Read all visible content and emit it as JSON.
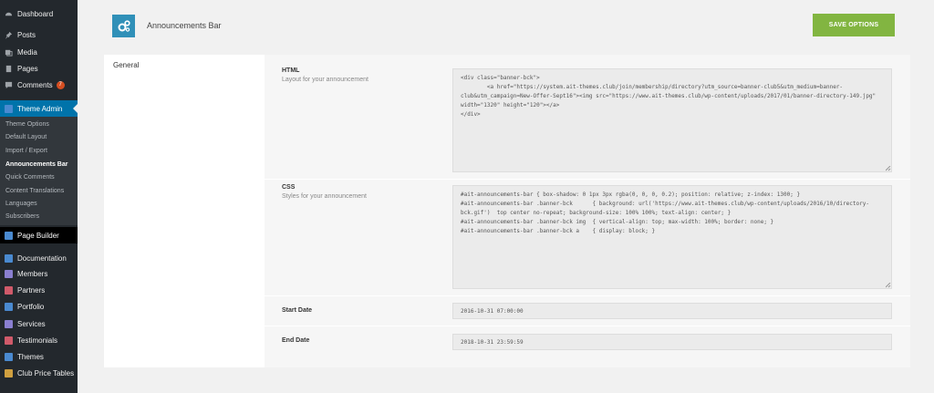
{
  "sidebar": {
    "top_items": [
      {
        "label": "Dashboard",
        "icon": "dashboard-icon"
      },
      {
        "label": "Posts",
        "icon": "pin-icon"
      },
      {
        "label": "Media",
        "icon": "media-icon"
      },
      {
        "label": "Pages",
        "icon": "pages-icon"
      },
      {
        "label": "Comments",
        "icon": "comments-icon",
        "badge": "7"
      }
    ],
    "theme_admin": {
      "label": "Theme Admin",
      "icon": "ait-icon"
    },
    "submenu": [
      {
        "label": "Theme Options"
      },
      {
        "label": "Default Layout"
      },
      {
        "label": "Import / Export"
      },
      {
        "label": "Announcements Bar"
      },
      {
        "label": "Quick Comments"
      },
      {
        "label": "Content Translations"
      },
      {
        "label": "Languages"
      },
      {
        "label": "Subscribers"
      }
    ],
    "page_builder": {
      "label": "Page Builder",
      "icon": "ait-icon"
    },
    "bottom_items": [
      {
        "label": "Documentation",
        "icon": "documentation-icon"
      },
      {
        "label": "Members",
        "icon": "members-icon"
      },
      {
        "label": "Partners",
        "icon": "partners-icon"
      },
      {
        "label": "Portfolio",
        "icon": "portfolio-icon"
      },
      {
        "label": "Services",
        "icon": "services-icon"
      },
      {
        "label": "Testimonials",
        "icon": "testimonials-icon"
      },
      {
        "label": "Themes",
        "icon": "themes-icon"
      },
      {
        "label": "Club Price Tables",
        "icon": "price-tables-icon"
      }
    ]
  },
  "header": {
    "title": "Announcements Bar",
    "icon": "gears-icon",
    "save_label": "SAVE OPTIONS"
  },
  "tabs": {
    "general": "General"
  },
  "options": {
    "html": {
      "label": "HTML",
      "help": "Layout for your announcement",
      "value": "<div class=\"banner-bck\">\n        <a href=\"https://system.ait-themes.club/join/membership/directory?utm_source=banner-club5&utm_medium=banner-club&utm_campaign=New-Offer-Sept16\"><img src=\"https://www.ait-themes.club/wp-content/uploads/2017/01/banner-directory-149.jpg\" width=\"1320\" height=\"120\"></a>\n</div>"
    },
    "css": {
      "label": "CSS",
      "help": "Styles for your announcement",
      "value": "#ait-announcements-bar { box-shadow: 0 1px 3px rgba(0, 0, 0, 0.2); position: relative; z-index: 1300; }\n#ait-announcements-bar .banner-bck      { background: url('https://www.ait-themes.club/wp-content/uploads/2016/10/directory-bck.gif')  top center no-repeat; background-size: 100% 100%; text-align: center; }\n#ait-announcements-bar .banner-bck img  { vertical-align: top; max-width: 100%; border: none; }\n#ait-announcements-bar .banner-bck a    { display: block; }"
    },
    "start_date": {
      "label": "Start Date",
      "value": "2016-10-31 07:00:00"
    },
    "end_date": {
      "label": "End Date",
      "value": "2018-10-31 23:59:59"
    }
  },
  "colors": {
    "sidebar_bg": "#23282d",
    "accent": "#0073aa",
    "save_button": "#82b541",
    "header_icon_bg": "#3090b8",
    "badge": "#d54e21"
  }
}
